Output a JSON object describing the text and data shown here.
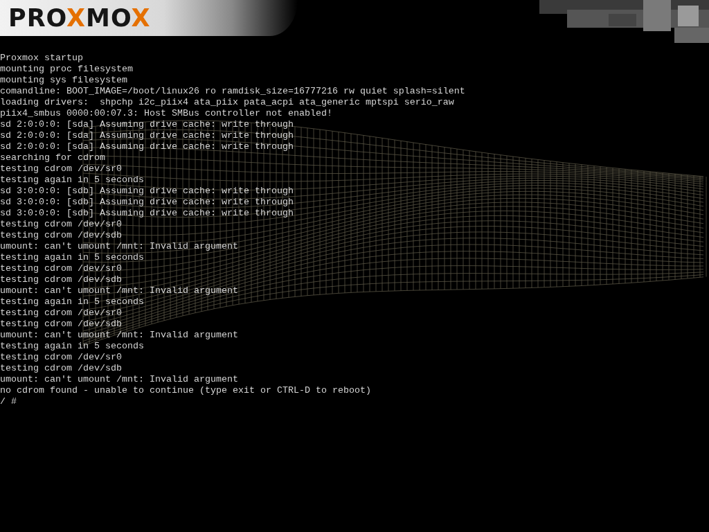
{
  "logo": [
    {
      "text": "PRO",
      "accent": false
    },
    {
      "text": "X",
      "accent": true
    },
    {
      "text": "MO",
      "accent": false
    },
    {
      "text": "X",
      "accent": true
    }
  ],
  "console": [
    "Proxmox startup",
    "mounting proc filesystem",
    "mounting sys filesystem",
    "comandline: BOOT_IMAGE=/boot/linux26 ro ramdisk_size=16777216 rw quiet splash=silent",
    "loading drivers:  shpchp i2c_piix4 ata_piix pata_acpi ata_generic mptspi serio_raw",
    "piix4_smbus 0000:00:07.3: Host SMBus controller not enabled!",
    "sd 2:0:0:0: [sda] Assuming drive cache: write through",
    "sd 2:0:0:0: [sda] Assuming drive cache: write through",
    "sd 2:0:0:0: [sda] Assuming drive cache: write through",
    "searching for cdrom",
    "testing cdrom /dev/sr0",
    "testing again in 5 seconds",
    "sd 3:0:0:0: [sdb] Assuming drive cache: write through",
    "sd 3:0:0:0: [sdb] Assuming drive cache: write through",
    "sd 3:0:0:0: [sdb] Assuming drive cache: write through",
    "testing cdrom /dev/sr0",
    "testing cdrom /dev/sdb",
    "umount: can't umount /mnt: Invalid argument",
    "testing again in 5 seconds",
    "testing cdrom /dev/sr0",
    "testing cdrom /dev/sdb",
    "umount: can't umount /mnt: Invalid argument",
    "testing again in 5 seconds",
    "testing cdrom /dev/sr0",
    "testing cdrom /dev/sdb",
    "umount: can't umount /mnt: Invalid argument",
    "testing again in 5 seconds",
    "testing cdrom /dev/sr0",
    "testing cdrom /dev/sdb",
    "umount: can't umount /mnt: Invalid argument",
    "no cdrom found - unable to continue (type exit or CTRL-D to reboot)"
  ],
  "prompt": "/ #"
}
